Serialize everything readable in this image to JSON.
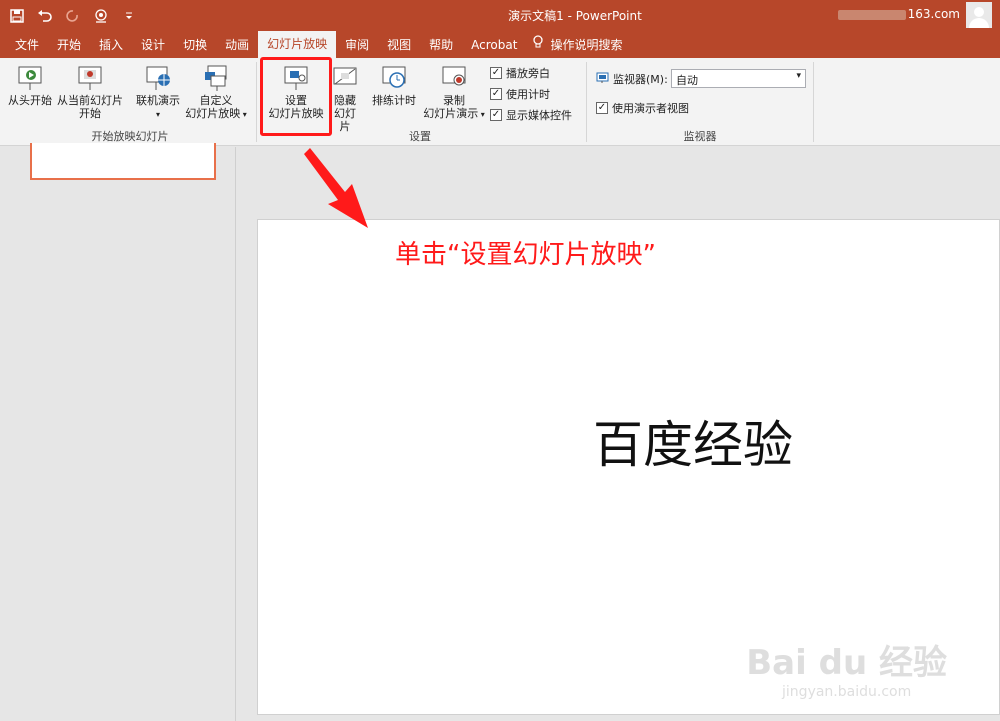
{
  "window": {
    "title": "演示文稿1  -  PowerPoint",
    "account": "163.com"
  },
  "quick_access": {
    "icons": [
      "save-icon",
      "undo-icon",
      "redo-icon",
      "touch-mode-icon",
      "customize-icon"
    ]
  },
  "tabs": [
    {
      "label": "文件"
    },
    {
      "label": "开始"
    },
    {
      "label": "插入"
    },
    {
      "label": "设计"
    },
    {
      "label": "切换"
    },
    {
      "label": "动画"
    },
    {
      "label": "幻灯片放映"
    },
    {
      "label": "审阅"
    },
    {
      "label": "视图"
    },
    {
      "label": "帮助"
    },
    {
      "label": "Acrobat"
    }
  ],
  "tell_me": "操作说明搜索",
  "ribbon": {
    "start_group": {
      "from_beginning": "从头开始",
      "from_current_1": "从当前幻灯片",
      "from_current_2": "开始",
      "online": "联机演示",
      "custom_1": "自定义",
      "custom_2": "幻灯片放映",
      "label": "开始放映幻灯片"
    },
    "setup_group": {
      "setup_1": "设置",
      "setup_2": "幻灯片放映",
      "hide_1": "隐藏",
      "hide_2": "幻灯片",
      "rehearse": "排练计时",
      "record_1": "录制",
      "record_2": "幻灯片演示",
      "play_narrations": "播放旁白",
      "use_timings": "使用计时",
      "show_media": "显示媒体控件",
      "label": "设置"
    },
    "monitor_group": {
      "monitor_label": "监视器(M):",
      "monitor_value": "自动",
      "presenter_view": "使用演示者视图",
      "label": "监视器"
    }
  },
  "slide": {
    "title": "百度经验"
  },
  "annotation": "单击“设置幻灯片放映”",
  "watermark": {
    "line1": "Bai du 经验",
    "line2": "jingyan.baidu.com"
  },
  "colors": {
    "accent": "#b7472a",
    "highlight": "#ff1a1a"
  }
}
